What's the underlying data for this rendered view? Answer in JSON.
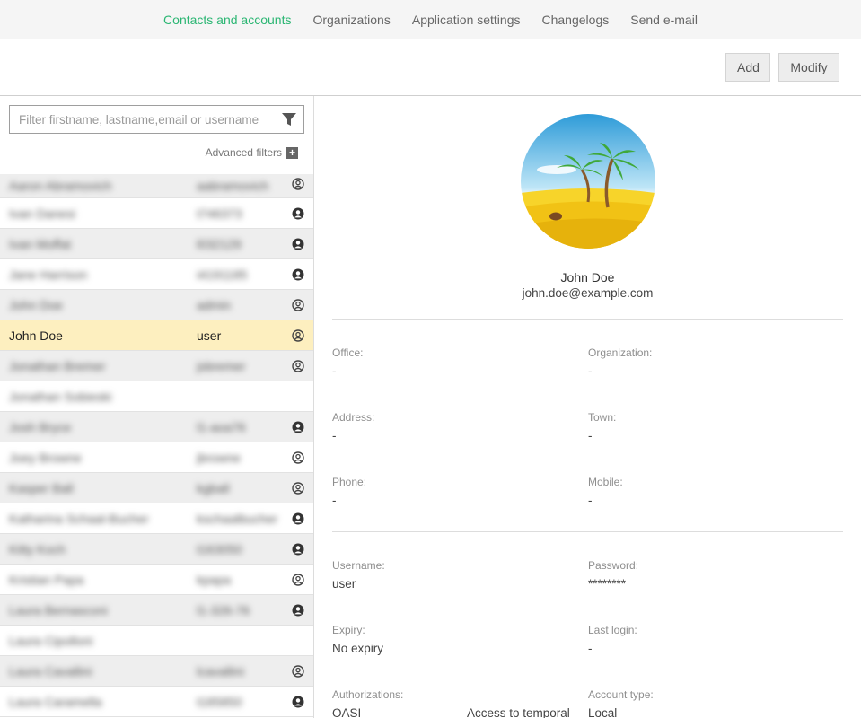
{
  "nav": {
    "items": [
      "Contacts and accounts",
      "Organizations",
      "Application settings",
      "Changelogs",
      "Send e-mail"
    ],
    "active_index": 0,
    "accent_color": "#2bb673"
  },
  "toolbar": {
    "add_label": "Add",
    "modify_label": "Modify"
  },
  "filter": {
    "placeholder": "Filter firstname, lastname,email or username",
    "value": "",
    "advanced_label": "Advanced filters"
  },
  "contacts": [
    {
      "name": "Aaron Abramovich",
      "username": "aabramovich",
      "icon": "user-outline-icon",
      "blurred": true
    },
    {
      "name": "Ivan Danesi",
      "username": "t746373",
      "icon": "user-filled-icon",
      "blurred": true
    },
    {
      "name": "Ivan Moffat",
      "username": "l032129",
      "icon": "user-filled-icon",
      "blurred": true
    },
    {
      "name": "Jane Harrison",
      "username": "i4191185",
      "icon": "user-filled-icon",
      "blurred": true
    },
    {
      "name": "John Doe",
      "username": "admin",
      "icon": "user-outline-icon",
      "blurred": true
    },
    {
      "name": "John Doe",
      "username": "user",
      "icon": "user-outline-icon",
      "blurred": false,
      "selected": true
    },
    {
      "name": "Jonathan Bremer",
      "username": "jsbremer",
      "icon": "user-outline-icon",
      "blurred": true
    },
    {
      "name": "Jonathan Sobieski",
      "username": "",
      "icon": "",
      "blurred": true
    },
    {
      "name": "Josh Bryce",
      "username": "l1-aoa76",
      "icon": "user-filled-icon",
      "blurred": true
    },
    {
      "name": "Joey Browne",
      "username": "jbrowne",
      "icon": "user-outline-icon",
      "blurred": true
    },
    {
      "name": "Kasper Ball",
      "username": "kgball",
      "icon": "user-outline-icon",
      "blurred": true
    },
    {
      "name": "Katharina Schaal-Bucher",
      "username": "kschaalbucher",
      "icon": "user-filled-icon",
      "blurred": true
    },
    {
      "name": "Kitty Koch",
      "username": "t163050",
      "icon": "user-filled-icon",
      "blurred": true
    },
    {
      "name": "Kristian Papa",
      "username": "kpapa",
      "icon": "user-outline-icon",
      "blurred": true
    },
    {
      "name": "Laura Bernasconi",
      "username": "l1-326-76",
      "icon": "user-filled-icon",
      "blurred": true
    },
    {
      "name": "Laura Cipolloni",
      "username": "",
      "icon": "",
      "blurred": true
    },
    {
      "name": "Laura Cavallini",
      "username": "lcavallini",
      "icon": "user-outline-icon",
      "blurred": true
    },
    {
      "name": "Laura Caramella",
      "username": "t185850",
      "icon": "user-filled-icon",
      "blurred": true
    }
  ],
  "profile": {
    "fullname": "John Doe",
    "email": "john.doe@example.com",
    "avatar": "palm-beach-avatar",
    "fields": {
      "office_label": "Office:",
      "office_value": "-",
      "organization_label": "Organization:",
      "organization_value": "-",
      "address_label": "Address:",
      "address_value": "-",
      "town_label": "Town:",
      "town_value": "-",
      "phone_label": "Phone:",
      "phone_value": "-",
      "mobile_label": "Mobile:",
      "mobile_value": "-",
      "username_label": "Username:",
      "username_value": "user",
      "password_label": "Password:",
      "password_value": "********",
      "expiry_label": "Expiry:",
      "expiry_value": "No expiry",
      "lastlogin_label": "Last login:",
      "lastlogin_value": "-",
      "authorizations_label": "Authorizations:",
      "authorizations_value_1": "OASI",
      "authorizations_value_2": "Access to temporal",
      "accounttype_label": "Account type:",
      "accounttype_value": "Local"
    }
  }
}
